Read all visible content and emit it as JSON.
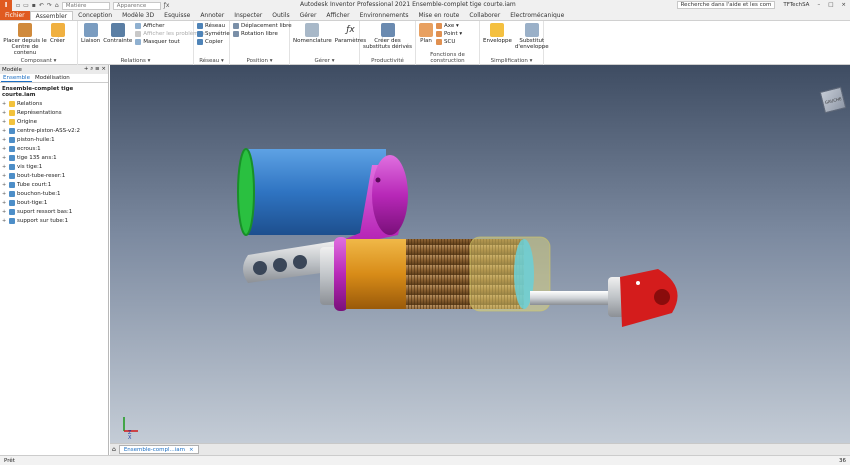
{
  "titlebar": {
    "logo": "I",
    "material": "Matière",
    "appearance": "Apparence",
    "title": "Autodesk Inventor Professional 2021    Ensemble-complet tige courte.iam",
    "search": "Recherche dans l'aide et les com",
    "user": "TFTechSA"
  },
  "tabs": [
    {
      "label": "Fichier",
      "kind": "file"
    },
    {
      "label": "Assembler",
      "kind": "active"
    },
    {
      "label": "Conception",
      "kind": ""
    },
    {
      "label": "Modèle 3D",
      "kind": ""
    },
    {
      "label": "Esquisse",
      "kind": ""
    },
    {
      "label": "Annoter",
      "kind": ""
    },
    {
      "label": "Inspecter",
      "kind": ""
    },
    {
      "label": "Outils",
      "kind": ""
    },
    {
      "label": "Gérer",
      "kind": ""
    },
    {
      "label": "Afficher",
      "kind": ""
    },
    {
      "label": "Environnements",
      "kind": ""
    },
    {
      "label": "Mise en route",
      "kind": ""
    },
    {
      "label": "Collaborer",
      "kind": ""
    },
    {
      "label": "Electromécanique",
      "kind": ""
    }
  ],
  "ribbon": {
    "composant": {
      "name": "Composant ▾",
      "place": "Placer depuis le Centre de contenu",
      "create": "Créer"
    },
    "relations": {
      "name": "Relations ▾",
      "liaison": "Liaison",
      "contrainte": "Contrainte",
      "afficher": "Afficher",
      "problemes": "Afficher les problèmes",
      "masquer": "Masquer tout"
    },
    "reseau": {
      "name": "Réseau ▾",
      "reseau": "Réseau",
      "symetrie": "Symétrie",
      "copier": "Copier"
    },
    "position": {
      "name": "Position ▾",
      "deplacement": "Déplacement libre",
      "rotation": "Rotation libre"
    },
    "gerer": {
      "name": "Gérer ▾",
      "nomenclature": "Nomenclature",
      "parametres": "Paramètres"
    },
    "productivite": {
      "name": "Productivité",
      "substituts": "Créer des substituts dérivés"
    },
    "construction": {
      "name": "Fonctions de construction",
      "plan": "Plan",
      "axe": "Axe ▾",
      "point": "Point ▾",
      "scu": "SCU"
    },
    "simplification": {
      "name": "Simplification ▾",
      "enveloppe": "Enveloppe",
      "substitut": "Substitut d'enveloppe"
    }
  },
  "panel": {
    "title": "Modèle",
    "tab1": "Ensemble",
    "tab2": "Modélisation",
    "root": "Ensemble-complet tige courte.iam",
    "items": [
      {
        "label": "Relations",
        "icon": "folder"
      },
      {
        "label": "Représentations",
        "icon": "folder"
      },
      {
        "label": "Origine",
        "icon": "folder"
      },
      {
        "label": "centre-piston-ASS-v2:2",
        "icon": "part"
      },
      {
        "label": "piston-huile:1",
        "icon": "part"
      },
      {
        "label": "ecrous:1",
        "icon": "part"
      },
      {
        "label": "tige 135 ans:1",
        "icon": "part"
      },
      {
        "label": "vis tige:1",
        "icon": "part"
      },
      {
        "label": "bout-tube-reser:1",
        "icon": "part"
      },
      {
        "label": "Tube court:1",
        "icon": "part"
      },
      {
        "label": "bouchon-tube:1",
        "icon": "part"
      },
      {
        "label": "bout-tige:1",
        "icon": "part"
      },
      {
        "label": "suport ressort bas:1",
        "icon": "part"
      },
      {
        "label": "support sur tube:1",
        "icon": "part"
      }
    ]
  },
  "viewport": {
    "viewcube": "GAUCHE",
    "triad_z": "Z",
    "triad_x": "X"
  },
  "docbar": {
    "home": "⌂",
    "doc": "Ensemble-compl...iam",
    "close": "×"
  },
  "status": {
    "left": "Prêt",
    "right": "36"
  },
  "colors": {
    "accent": "#e05a20",
    "link": "#1b6ec2"
  }
}
